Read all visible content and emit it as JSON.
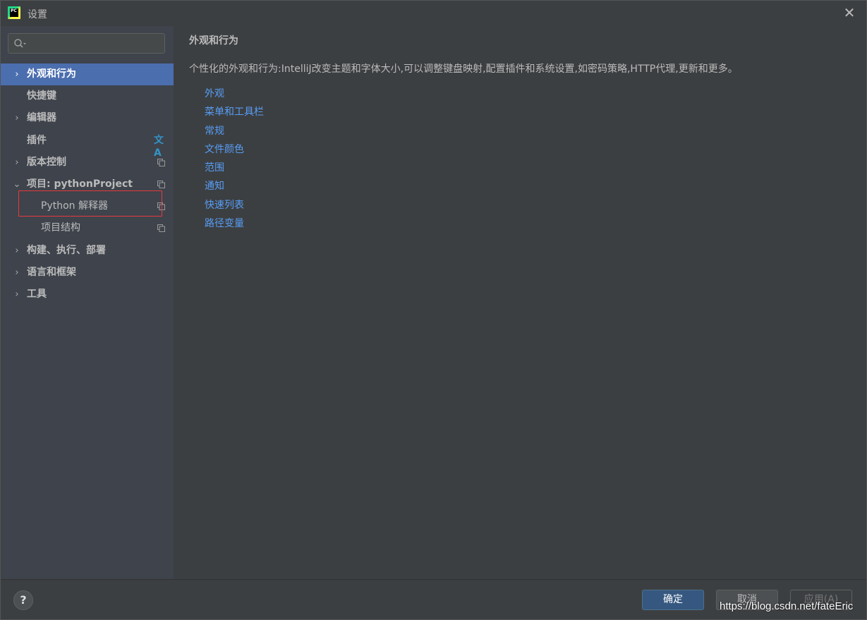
{
  "window": {
    "title": "设置",
    "logo_text": "PC"
  },
  "search": {
    "placeholder": ""
  },
  "sidebar": {
    "items": [
      {
        "label": "外观和行为",
        "arrow": "›"
      },
      {
        "label": "快捷键",
        "arrow": ""
      },
      {
        "label": "编辑器",
        "arrow": "›"
      },
      {
        "label": "插件",
        "arrow": ""
      },
      {
        "label": "版本控制",
        "arrow": "›"
      },
      {
        "label": "项目: pythonProject",
        "arrow": "⌄"
      },
      {
        "label": "Python 解释器",
        "arrow": ""
      },
      {
        "label": "项目结构",
        "arrow": ""
      },
      {
        "label": "构建、执行、部署",
        "arrow": "›"
      },
      {
        "label": "语言和框架",
        "arrow": "›"
      },
      {
        "label": "工具",
        "arrow": "›"
      }
    ],
    "selected_index": 0
  },
  "main": {
    "title": "外观和行为",
    "description": "个性化的外观和行为:IntelliJ改变主题和字体大小,可以调整键盘映射,配置插件和系统设置,如密码策略,HTTP代理,更新和更多。",
    "links": [
      "外观",
      "菜单和工具栏",
      "常规",
      "文件颜色",
      "范围",
      "通知",
      "快速列表",
      "路径变量"
    ]
  },
  "buttons": {
    "help": "?",
    "ok": "确定",
    "cancel": "取消",
    "apply": "应用(A)"
  },
  "watermark": "https://blog.csdn.net/fateEric",
  "colors": {
    "selection": "#4b6eaf",
    "link": "#589df6",
    "highlight_border": "#e8383d"
  }
}
